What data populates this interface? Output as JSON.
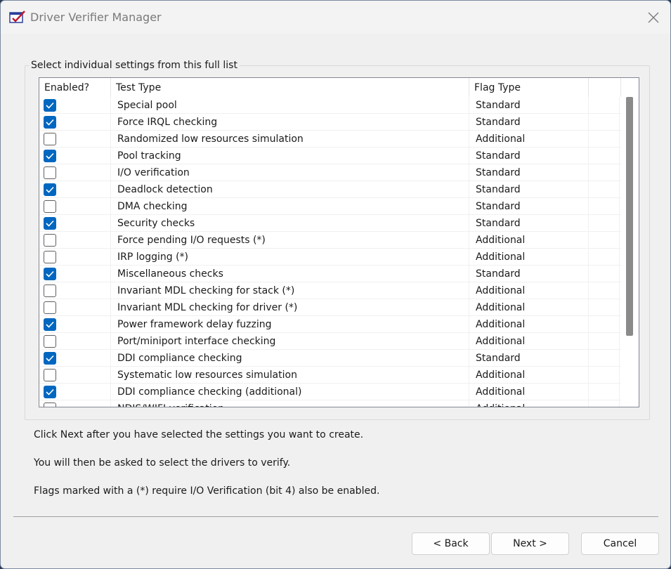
{
  "window": {
    "title": "Driver Verifier Manager"
  },
  "groupbox": {
    "label": "Select individual settings from this full list"
  },
  "table": {
    "headers": [
      "Enabled?",
      "Test Type",
      "Flag Type"
    ],
    "rows": [
      {
        "enabled": true,
        "test": "Special pool",
        "flag": "Standard"
      },
      {
        "enabled": true,
        "test": "Force IRQL checking",
        "flag": "Standard"
      },
      {
        "enabled": false,
        "test": "Randomized low resources simulation",
        "flag": "Additional"
      },
      {
        "enabled": true,
        "test": "Pool tracking",
        "flag": "Standard"
      },
      {
        "enabled": false,
        "test": "I/O verification",
        "flag": "Standard"
      },
      {
        "enabled": true,
        "test": "Deadlock detection",
        "flag": "Standard"
      },
      {
        "enabled": false,
        "test": "DMA checking",
        "flag": "Standard"
      },
      {
        "enabled": true,
        "test": "Security checks",
        "flag": "Standard"
      },
      {
        "enabled": false,
        "test": "Force pending I/O requests (*)",
        "flag": "Additional"
      },
      {
        "enabled": false,
        "test": "IRP logging (*)",
        "flag": "Additional"
      },
      {
        "enabled": true,
        "test": "Miscellaneous checks",
        "flag": "Standard"
      },
      {
        "enabled": false,
        "test": "Invariant MDL checking for stack (*)",
        "flag": "Additional"
      },
      {
        "enabled": false,
        "test": "Invariant MDL checking for driver (*)",
        "flag": "Additional"
      },
      {
        "enabled": true,
        "test": "Power framework delay fuzzing",
        "flag": "Additional"
      },
      {
        "enabled": false,
        "test": "Port/miniport interface checking",
        "flag": "Additional"
      },
      {
        "enabled": true,
        "test": "DDI compliance checking",
        "flag": "Standard"
      },
      {
        "enabled": false,
        "test": "Systematic low resources simulation",
        "flag": "Additional"
      },
      {
        "enabled": true,
        "test": "DDI compliance checking (additional)",
        "flag": "Additional"
      },
      {
        "enabled": false,
        "test": "NDIS/WIFI verification",
        "flag": "Additional"
      }
    ]
  },
  "info": {
    "line1": "Click Next after you have selected the settings you want to create.",
    "line2": "You will then be asked to select the drivers to verify.",
    "line3": "Flags marked with a (*) require I/O Verification (bit 4) also be enabled."
  },
  "buttons": {
    "back": "< Back",
    "next": "Next >",
    "cancel": "Cancel"
  },
  "colors": {
    "checkbox_checked": "#0067c0",
    "window_bg": "#f0f0f0"
  },
  "icons": {
    "app": "driver-verifier-icon",
    "close": "close-icon",
    "check": "checkmark-icon"
  }
}
